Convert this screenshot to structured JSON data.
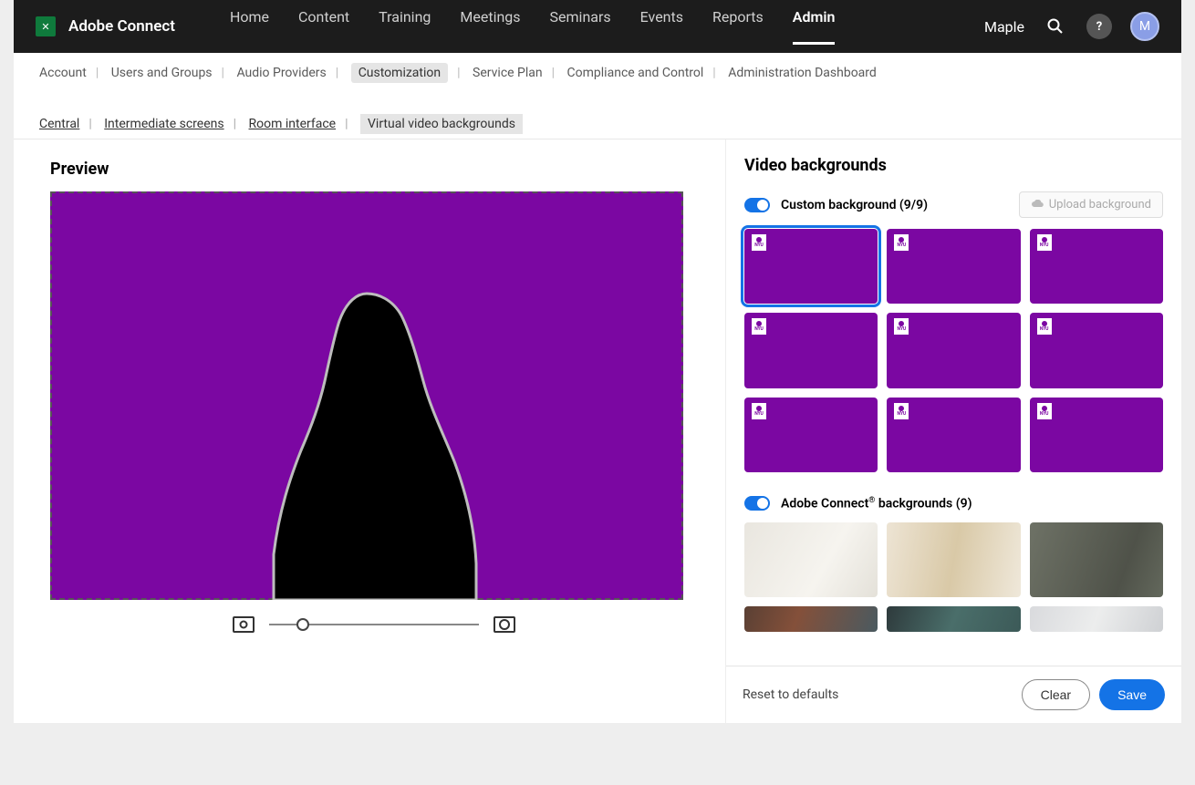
{
  "brand": {
    "name": "Adobe Connect"
  },
  "nav": {
    "items": [
      "Home",
      "Content",
      "Training",
      "Meetings",
      "Seminars",
      "Events",
      "Reports",
      "Admin"
    ],
    "active": "Admin"
  },
  "user": {
    "name": "Maple",
    "initial": "M"
  },
  "subnav": {
    "items": [
      "Account",
      "Users and Groups",
      "Audio Providers",
      "Customization",
      "Service Plan",
      "Compliance and Control",
      "Administration Dashboard"
    ],
    "active": "Customization"
  },
  "subnav2": {
    "items": [
      "Central",
      "Intermediate screens",
      "Room interface",
      "Virtual video backgrounds"
    ],
    "active": "Virtual video backgrounds"
  },
  "preview": {
    "title": "Preview"
  },
  "right": {
    "title": "Video backgrounds",
    "custom_label": "Custom background (9/9)",
    "upload_label": "Upload background",
    "badge_text": "NYU",
    "adobe_label_prefix": "Adobe Connect",
    "adobe_label_suffix": " backgrounds (9)",
    "reset": "Reset to defaults",
    "clear": "Clear",
    "save": "Save"
  },
  "colors": {
    "accent": "#1473e6",
    "bg_purple": "#7b07a2"
  }
}
